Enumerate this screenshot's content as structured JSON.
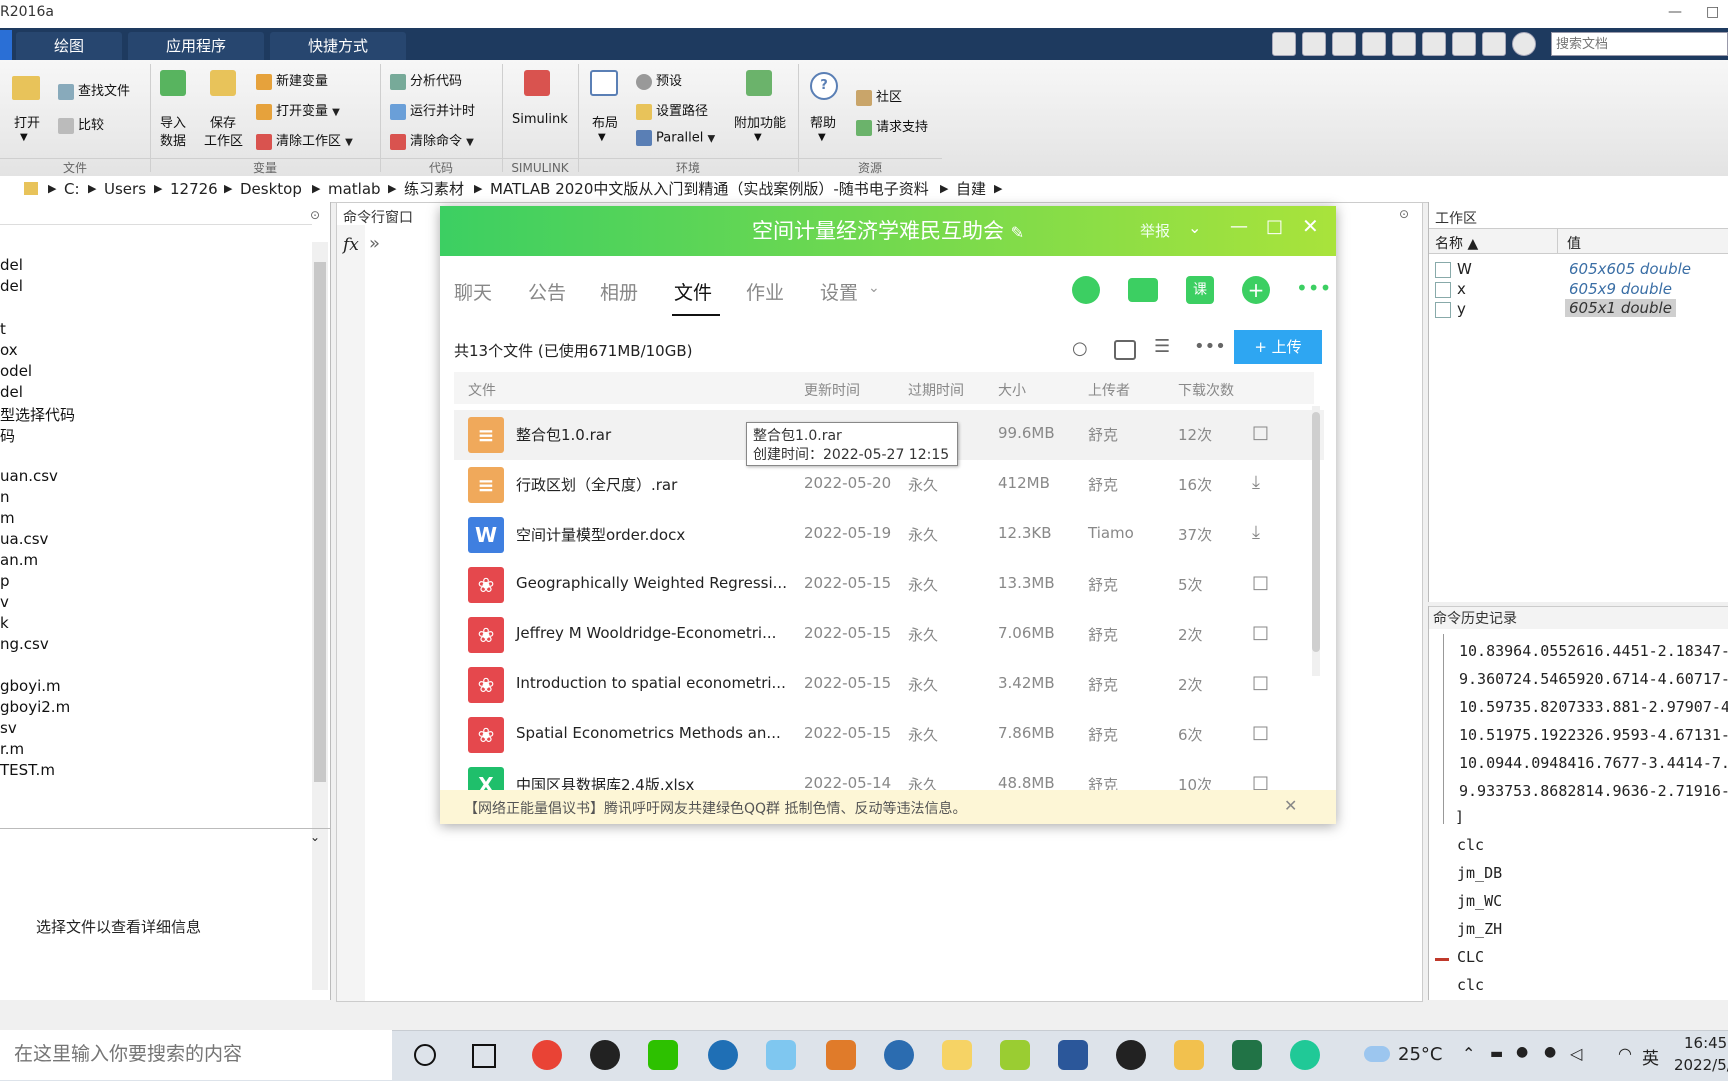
{
  "app": {
    "title": "R2016a",
    "tabs": [
      "绘图",
      "应用程序",
      "快捷方式"
    ],
    "doc_search_placeholder": "搜索文档",
    "window_controls": [
      "—",
      "□"
    ]
  },
  "ribbon": {
    "file": {
      "open": "打开",
      "find_files": "查找文件",
      "compare": "比较",
      "group": "文件"
    },
    "variable": {
      "import": "导入",
      "import2": "数据",
      "save": "保存",
      "save2": "工作区",
      "new_var": "新建变量",
      "open_var": "打开变量",
      "clear_ws": "清除工作区",
      "group": "变量"
    },
    "code": {
      "analyze": "分析代码",
      "run_time": "运行并计时",
      "clear_cmd": "清除命令",
      "group": "代码"
    },
    "simulink": {
      "label": "Simulink",
      "group": "SIMULINK"
    },
    "env": {
      "layout": "布局",
      "prefs": "预设",
      "set_path": "设置路径",
      "parallel": "Parallel",
      "addons": "附加功能",
      "group": "环境"
    },
    "resources": {
      "help": "帮助",
      "community": "社区",
      "request": "请求支持",
      "group": "资源"
    }
  },
  "path": {
    "segments": [
      "C:",
      "Users",
      "12726",
      "Desktop",
      "matlab",
      "练习素材",
      "MATLAB 2020中文版从入门到精通（实战案例版）-随书电子资料",
      "自建"
    ]
  },
  "left_panel": {
    "files": [
      "del",
      "del",
      "t",
      "ox",
      "odel",
      "del",
      "型选择代码",
      "码",
      "uan.csv",
      "n",
      "m",
      "ua.csv",
      "an.m",
      "p",
      "v",
      "k",
      "ng.csv",
      "gboyi.m",
      "gboyi2.m",
      "sv",
      "r.m",
      "TEST.m"
    ],
    "details_hint": "选择文件以查看详细信息"
  },
  "cmd_window": {
    "title": "命令行窗口",
    "fx": "fx",
    "prompt": "»"
  },
  "workspace": {
    "title": "工作区",
    "col_name": "名称 ▲",
    "col_value": "值",
    "vars": [
      {
        "name": "W",
        "value": "605x605 double"
      },
      {
        "name": "x",
        "value": "605x9 double"
      },
      {
        "name": "y",
        "value": "605x1 double"
      }
    ]
  },
  "history": {
    "title": "命令历史记录",
    "lines": [
      "10.83964.0552616.4451-2.18347-",
      "9.360724.5465920.6714-4.60717-",
      "10.59735.8207333.881-2.97907-4",
      "10.51975.1922326.9593-4.67131-",
      "10.0944.0948416.7677-3.4414-7.",
      "9.933753.8682814.9636-2.71916-"
    ],
    "bracket": "]",
    "commands": [
      "clc",
      "jm_DB",
      "jm_WC",
      "jm_ZH",
      "CLC",
      "clc"
    ]
  },
  "qq": {
    "title": "空间计量经济学难民互助会",
    "report": "举报",
    "tabs": [
      "聊天",
      "公告",
      "相册",
      "文件",
      "作业",
      "设置"
    ],
    "summary": "共13个文件 (已使用671MB/10GB)",
    "upload": "上传",
    "headers": {
      "file": "文件",
      "updated": "更新时间",
      "expire": "过期时间",
      "size": "大小",
      "uploader": "上传者",
      "downloads": "下载次数"
    },
    "files": [
      {
        "name": "整合包1.0.rar",
        "date": "",
        "expire": "",
        "size": "99.6MB",
        "uploader": "舒克",
        "downloads": "12次",
        "type": "zip",
        "color": "#f0a95b"
      },
      {
        "name": "行政区划（全尺度）.rar",
        "date": "2022-05-20",
        "expire": "永久",
        "size": "412MB",
        "uploader": "舒克",
        "downloads": "16次",
        "type": "zip",
        "color": "#f0a95b"
      },
      {
        "name": "空间计量模型order.docx",
        "date": "2022-05-19",
        "expire": "永久",
        "size": "12.3KB",
        "uploader": "Tiamo",
        "downloads": "37次",
        "type": "W",
        "color": "#3f7fe0"
      },
      {
        "name": "Geographically Weighted Regressi...",
        "date": "2022-05-15",
        "expire": "永久",
        "size": "13.3MB",
        "uploader": "舒克",
        "downloads": "5次",
        "type": "pdf",
        "color": "#e5484d"
      },
      {
        "name": "Jeffrey M Wooldridge-Econometri...",
        "date": "2022-05-15",
        "expire": "永久",
        "size": "7.06MB",
        "uploader": "舒克",
        "downloads": "2次",
        "type": "pdf",
        "color": "#e5484d"
      },
      {
        "name": "Introduction to spatial econometri...",
        "date": "2022-05-15",
        "expire": "永久",
        "size": "3.42MB",
        "uploader": "舒克",
        "downloads": "2次",
        "type": "pdf",
        "color": "#e5484d"
      },
      {
        "name": "Spatial Econometrics Methods an...",
        "date": "2022-05-15",
        "expire": "永久",
        "size": "7.86MB",
        "uploader": "舒克",
        "downloads": "6次",
        "type": "pdf",
        "color": "#e5484d"
      },
      {
        "name": "中国区县数据库2.4版.xlsx",
        "date": "2022-05-14",
        "expire": "永久",
        "size": "48.8MB",
        "uploader": "舒克",
        "downloads": "10次",
        "type": "X",
        "color": "#1fbf6b"
      }
    ],
    "tooltip": {
      "name": "整合包1.0.rar",
      "created": "创建时间：2022-05-27 12:15"
    },
    "notice": "【网络正能量倡议书】腾讯呼吁网友共建绿色QQ群 抵制色情、反动等违法信息。"
  },
  "taskbar": {
    "search_placeholder": "在这里输入你要搜索的内容",
    "temp": "25°C",
    "ime": "英",
    "time": "16:45",
    "date": "2022/5/"
  }
}
